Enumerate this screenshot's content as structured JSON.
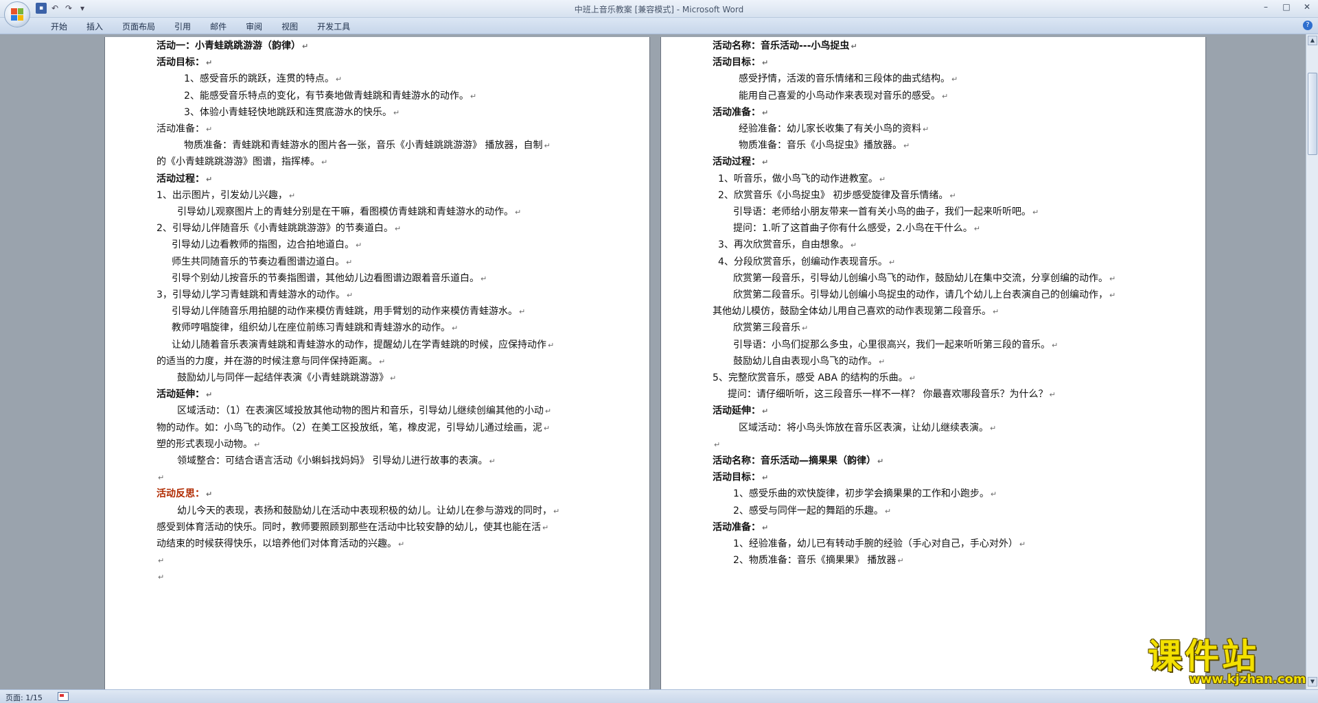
{
  "window": {
    "title": "中班上音乐教案 [兼容模式] - Microsoft Word",
    "controls": [
      "–",
      "□",
      "✕"
    ]
  },
  "qat": {
    "save": "▪",
    "undo": "↶",
    "redo": "↷",
    "more": "▾"
  },
  "ribbon": {
    "tabs": [
      "开始",
      "插入",
      "页面布局",
      "引用",
      "邮件",
      "审阅",
      "视图",
      "开发工具"
    ],
    "help": "?"
  },
  "left_page": {
    "lines": [
      {
        "text": "活动一：小青蛙跳跳游游（韵律）",
        "style": "bold",
        "indent": 0
      },
      {
        "text": "活动目标：",
        "style": "bold",
        "indent": 0
      },
      {
        "text": "1、感受音乐的跳跃，连贯的特点。",
        "style": "",
        "indent": 40
      },
      {
        "text": "2、能感受音乐特点的变化，有节奏地做青蛙跳和青蛙游水的动作。",
        "style": "",
        "indent": 40
      },
      {
        "text": "3、体验小青蛙轻快地跳跃和连贯底游水的快乐。",
        "style": "",
        "indent": 40
      },
      {
        "text": "活动准备：",
        "style": "",
        "indent": 0
      },
      {
        "text": "物质准备：青蛙跳和青蛙游水的图片各一张，音乐《小青蛙跳跳游游》 播放器，自制",
        "style": "",
        "indent": 40
      },
      {
        "text": "的《小青蛙跳跳游游》图谱，指挥棒。",
        "style": "",
        "indent": 0
      },
      {
        "text": "活动过程：",
        "style": "bold",
        "indent": 0
      },
      {
        "text": "1、出示图片，引发幼儿兴趣，",
        "style": "",
        "indent": 0
      },
      {
        "text": "引导幼儿观察图片上的青蛙分别是在干嘛，看图模仿青蛙跳和青蛙游水的动作。",
        "style": "",
        "indent": 30
      },
      {
        "text": "2、引导幼儿伴随音乐《小青蛙跳跳游游》的节奏道白。",
        "style": "",
        "indent": 0
      },
      {
        "text": "引导幼儿边看教师的指图，边合拍地道白。",
        "style": "",
        "indent": 22
      },
      {
        "text": "师生共同随音乐的节奏边看图谱边道白。",
        "style": "",
        "indent": 22
      },
      {
        "text": "引导个别幼儿按音乐的节奏指图谱，其他幼儿边看图谱边跟着音乐道白。",
        "style": "",
        "indent": 22
      },
      {
        "text": "3，引导幼儿学习青蛙跳和青蛙游水的动作。",
        "style": "",
        "indent": 0
      },
      {
        "text": "引导幼儿伴随音乐用拍腿的动作来模仿青蛙跳，用手臂划的动作来模仿青蛙游水。",
        "style": "",
        "indent": 22
      },
      {
        "text": "教师哼唱旋律，组织幼儿在座位前练习青蛙跳和青蛙游水的动作。",
        "style": "",
        "indent": 22
      },
      {
        "text": "让幼儿随着音乐表演青蛙跳和青蛙游水的动作，提醒幼儿在学青蛙跳的时候，应保持动作",
        "style": "",
        "indent": 22
      },
      {
        "text": "的适当的力度，并在游的时候注意与同伴保持距离。",
        "style": "",
        "indent": 0
      },
      {
        "text": "鼓励幼儿与同伴一起结伴表演《小青蛙跳跳游游》",
        "style": "",
        "indent": 30
      },
      {
        "text": "活动延伸：",
        "style": "bold",
        "indent": 0
      },
      {
        "text": "区域活动：（1）在表演区域投放其他动物的图片和音乐，引导幼儿继续创编其他的小动",
        "style": "",
        "indent": 30
      },
      {
        "text": "物的动作。如：小鸟飞的动作。（2）在美工区投放纸，笔，橡皮泥，引导幼儿通过绘画，泥",
        "style": "",
        "indent": 0
      },
      {
        "text": "塑的形式表现小动物。",
        "style": "",
        "indent": 0
      },
      {
        "text": "领域整合：可结合语言活动《小蝌蚪找妈妈》 引导幼儿进行故事的表演。",
        "style": "",
        "indent": 30
      },
      {
        "text": "",
        "style": "",
        "indent": 0
      },
      {
        "text": "活动反思：",
        "style": "red",
        "indent": 0
      },
      {
        "text": "幼儿今天的表现，表扬和鼓励幼儿在活动中表现积极的幼儿。让幼儿在参与游戏的同时，",
        "style": "",
        "indent": 30
      },
      {
        "text": "感受到体育活动的快乐。同时，教师要照顾到那些在活动中比较安静的幼儿，使其也能在活",
        "style": "",
        "indent": 0
      },
      {
        "text": "动结束的时候获得快乐，以培养他们对体育活动的兴趣。",
        "style": "",
        "indent": 0
      },
      {
        "text": "",
        "style": "",
        "indent": 0
      },
      {
        "text": "",
        "style": "",
        "indent": 0
      }
    ]
  },
  "right_page": {
    "lines": [
      {
        "text": "活动名称：音乐活动---小鸟捉虫",
        "style": "bold",
        "indent": 0
      },
      {
        "text": "活动目标：",
        "style": "bold",
        "indent": 0
      },
      {
        "text": "感受抒情，活泼的音乐情绪和三段体的曲式结构。",
        "style": "",
        "indent": 38
      },
      {
        "text": "能用自己喜爱的小鸟动作来表现对音乐的感受。",
        "style": "",
        "indent": 38
      },
      {
        "text": "活动准备：",
        "style": "bold",
        "indent": 0
      },
      {
        "text": "经验准备：幼儿家长收集了有关小鸟的资料",
        "style": "",
        "indent": 38
      },
      {
        "text": "物质准备：音乐《小鸟捉虫》播放器。",
        "style": "",
        "indent": 38
      },
      {
        "text": "活动过程：",
        "style": "bold",
        "indent": 0
      },
      {
        "text": "1、听音乐，做小鸟飞的动作进教室。",
        "style": "",
        "indent": 8
      },
      {
        "text": "2、欣赏音乐《小鸟捉虫》 初步感受旋律及音乐情绪。",
        "style": "",
        "indent": 8
      },
      {
        "text": "引导语：老师给小朋友带来一首有关小鸟的曲子，我们一起来听听吧。",
        "style": "",
        "indent": 30
      },
      {
        "text": "提问：1.听了这首曲子你有什么感受，2.小鸟在干什么。",
        "style": "",
        "indent": 30
      },
      {
        "text": "3、再次欣赏音乐，自由想象。",
        "style": "",
        "indent": 8
      },
      {
        "text": "4、分段欣赏音乐，创编动作表现音乐。",
        "style": "",
        "indent": 8
      },
      {
        "text": "欣赏第一段音乐，引导幼儿创编小鸟飞的动作，鼓励幼儿在集中交流，分享创编的动作。",
        "style": "",
        "indent": 30
      },
      {
        "text": "欣赏第二段音乐。引导幼儿创编小鸟捉虫的动作，请几个幼儿上台表演自己的创编动作，",
        "style": "",
        "indent": 30
      },
      {
        "text": "其他幼儿模仿，鼓励全体幼儿用自己喜欢的动作表现第二段音乐。",
        "style": "",
        "indent": 0
      },
      {
        "text": "欣赏第三段音乐",
        "style": "",
        "indent": 30
      },
      {
        "text": "引导语：小鸟们捉那么多虫，心里很高兴，我们一起来听听第三段的音乐。",
        "style": "",
        "indent": 30
      },
      {
        "text": "鼓励幼儿自由表现小鸟飞的动作。",
        "style": "",
        "indent": 30
      },
      {
        "text": "5、完整欣赏音乐，感受 ABA 的结构的乐曲。",
        "style": "",
        "indent": 0
      },
      {
        "text": "提问：请仔细听听，这三段音乐一样不一样？ 你最喜欢哪段音乐？为什么？",
        "style": "",
        "indent": 22
      },
      {
        "text": "活动延伸：",
        "style": "bold",
        "indent": 0
      },
      {
        "text": "区域活动：将小鸟头饰放在音乐区表演，让幼儿继续表演。",
        "style": "",
        "indent": 38
      },
      {
        "text": "",
        "style": "",
        "indent": 0
      },
      {
        "text": "活动名称：音乐活动—摘果果（韵律）",
        "style": "bold",
        "indent": 0
      },
      {
        "text": "活动目标：",
        "style": "bold",
        "indent": 0
      },
      {
        "text": "1、感受乐曲的欢快旋律，初步学会摘果果的工作和小跑步。",
        "style": "",
        "indent": 30
      },
      {
        "text": "2、感受与同伴一起的舞蹈的乐趣。",
        "style": "",
        "indent": 30
      },
      {
        "text": "活动准备：",
        "style": "bold",
        "indent": 0
      },
      {
        "text": "1、经验准备，幼儿已有转动手腕的经验（手心对自己，手心对外）",
        "style": "",
        "indent": 30
      },
      {
        "text": "2、物质准备：音乐《摘果果》 播放器",
        "style": "",
        "indent": 30
      }
    ]
  },
  "statusbar": {
    "page_count": "页面: 1/15"
  },
  "scrollbar": {
    "up": "▲",
    "down": "▼"
  },
  "watermark": {
    "text": "课件站",
    "url": "www.kjzhan.com"
  }
}
